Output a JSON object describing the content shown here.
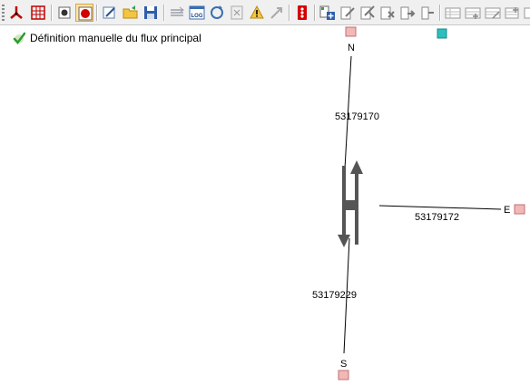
{
  "toolbar": {
    "buttons": [
      {
        "id": "select-arrow",
        "icon": "junction-tool-icon"
      },
      {
        "id": "grid-select",
        "icon": "grid-select-icon"
      },
      {
        "id": "node-point",
        "icon": "node-point-icon"
      },
      {
        "id": "node-point-active",
        "icon": "node-point-active-icon",
        "active": true
      },
      {
        "id": "edit-properties",
        "icon": "edit-properties-icon"
      },
      {
        "id": "open-file",
        "icon": "open-folder-icon"
      },
      {
        "id": "save-file",
        "icon": "save-icon"
      },
      {
        "id": "lanes",
        "icon": "lanes-icon"
      },
      {
        "id": "log-view",
        "icon": "log-window-icon"
      },
      {
        "id": "log-refresh",
        "icon": "log-refresh-icon"
      },
      {
        "id": "log-clear",
        "icon": "log-clear-icon"
      },
      {
        "id": "log-warning",
        "icon": "log-warning-icon"
      },
      {
        "id": "export-arrow",
        "icon": "export-arrow-icon"
      },
      {
        "id": "traffic-light",
        "icon": "traffic-light-icon"
      },
      {
        "id": "add-phase",
        "icon": "add-phase-icon"
      },
      {
        "id": "edit-phase",
        "icon": "edit-phase-icon"
      },
      {
        "id": "edit-phase-2",
        "icon": "edit-phase-alt-icon"
      },
      {
        "id": "delete-phase",
        "icon": "delete-phase-icon"
      },
      {
        "id": "move-phase",
        "icon": "move-phase-icon"
      },
      {
        "id": "phase-split",
        "icon": "phase-split-icon"
      },
      {
        "id": "table-1",
        "icon": "table-icon"
      },
      {
        "id": "table-add",
        "icon": "table-add-icon"
      },
      {
        "id": "table-edit",
        "icon": "table-edit-icon"
      },
      {
        "id": "table-remove",
        "icon": "table-remove-icon"
      },
      {
        "id": "table-more",
        "icon": "table-more-icon"
      }
    ],
    "label_log": "LOG"
  },
  "status": {
    "icon": "check-icon",
    "text": "Définition manuelle du flux principal"
  },
  "diagram": {
    "directions": {
      "north": "N",
      "east": "E",
      "south": "S"
    },
    "links": [
      {
        "direction": "north",
        "id": "53179170"
      },
      {
        "direction": "east",
        "id": "53179172"
      },
      {
        "direction": "south",
        "id": "53179229"
      }
    ],
    "colors": {
      "node_fill": "#f2b8b8",
      "node_stroke": "#c07070",
      "marker_fill": "#2bbfbf",
      "flow_fill": "#555555",
      "line": "#000000"
    }
  }
}
